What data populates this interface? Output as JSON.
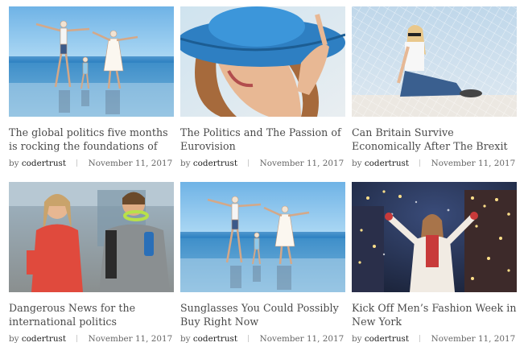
{
  "posts": [
    {
      "title": "The global politics five months is rocking the foundations of",
      "by": "by",
      "author": "codertrust",
      "date": "November 11, 2017",
      "image": "family-beach-photo"
    },
    {
      "title": "The Politics and The Passion of Eurovision",
      "by": "by",
      "author": "codertrust",
      "date": "November 11, 2017",
      "image": "woman-blue-hat-photo"
    },
    {
      "title": "Can Britain Survive Economically After The Brexit Implementation?",
      "by": "by",
      "author": "codertrust",
      "date": "November 11, 2017",
      "image": "woman-beach-net-photo"
    },
    {
      "title": "Dangerous News for the international politics",
      "by": "by",
      "author": "codertrust",
      "date": "November 11, 2017",
      "image": "couple-city-photo"
    },
    {
      "title": "Sunglasses You Could Possibly Buy Right Now",
      "by": "by",
      "author": "codertrust",
      "date": "November 11, 2017",
      "image": "family-beach-photo"
    },
    {
      "title": "Kick Off Men’s Fashion Week in New York",
      "by": "by",
      "author": "codertrust",
      "date": "November 11, 2017",
      "image": "woman-christmas-lights-photo"
    }
  ]
}
